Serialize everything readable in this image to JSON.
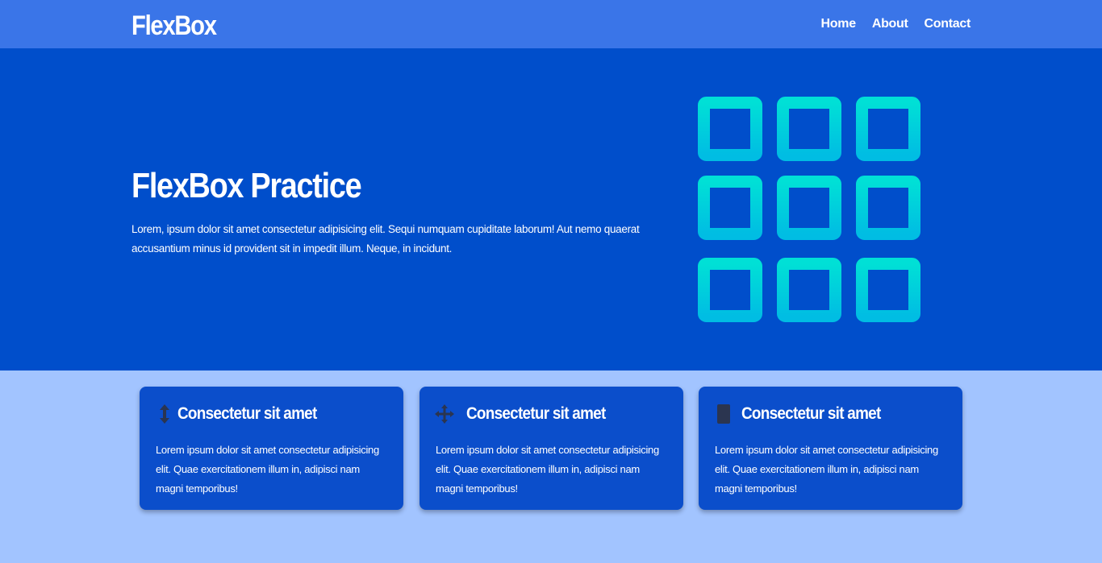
{
  "navbar": {
    "logo": "FlexBox",
    "links": [
      "Home",
      "About",
      "Contact"
    ]
  },
  "hero": {
    "title": "FlexBox Practice",
    "text": "Lorem, ipsum dolor sit amet consectetur adipisicing elit. Sequi numquam cupiditate laborum! Aut nemo quaerat accusantium minus id provident sit in impedit illum. Neque, in incidunt.",
    "graphic_icon": "grid-squares-icon"
  },
  "cards": [
    {
      "icon": "arrows-up-down-icon",
      "title": "Consectetur sit amet",
      "text": "Lorem ipsum dolor sit amet consectetur adipisicing elit. Quae exercitationem illum in, adipisci nam magni temporibus!"
    },
    {
      "icon": "arrows-move-icon",
      "title": "Consectetur sit amet",
      "text": "Lorem ipsum dolor sit amet consectetur adipisicing elit. Quae exercitationem illum in, adipisci nam magni temporibus!"
    },
    {
      "icon": "tablet-icon",
      "title": "Consectetur sit amet",
      "text": "Lorem ipsum dolor sit amet consectetur adipisicing elit. Quae exercitationem illum in, adipisci nam magni temporibus!"
    }
  ],
  "colors": {
    "navbar": "#3a75e8",
    "hero": "#004ecb",
    "page_background": "#a2c4ff",
    "card": "#0b4ecb",
    "grid_gradient_top": "#00e0d6",
    "grid_gradient_bottom": "#00bde3",
    "icon": "#2b3550"
  }
}
